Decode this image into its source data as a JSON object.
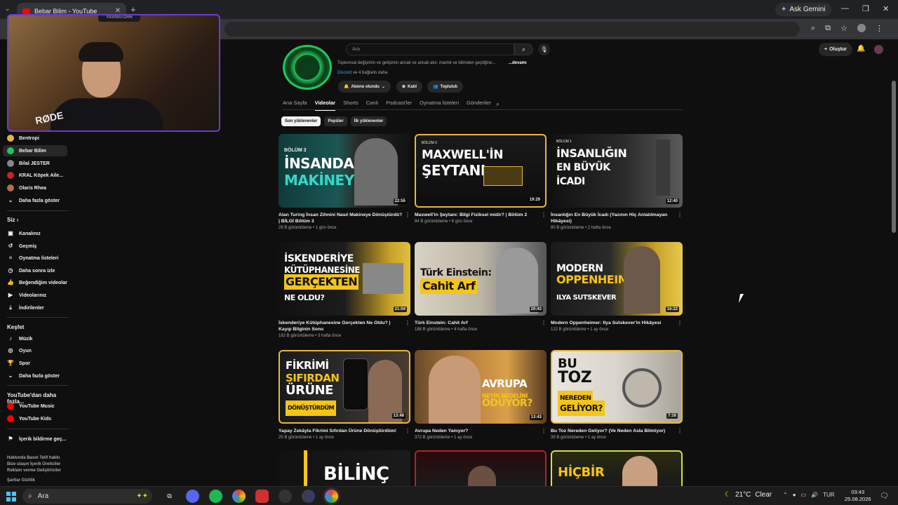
{
  "browser": {
    "tab_title": "Bebar Bilim - YouTube",
    "gemini_label": "Ask Gemini"
  },
  "youtube": {
    "search_placeholder": "Ara",
    "create_label": "Oluştur"
  },
  "webcam": {
    "overlay_name": "YASINATORR",
    "mic_brand": "RØDE"
  },
  "sidebar": {
    "subscriptions": [
      {
        "label": "Bentropi",
        "color": "#e8b04a"
      },
      {
        "label": "Bebar Bilim",
        "color": "#22c55e"
      },
      {
        "label": "Bilal JESTER",
        "color": "#888888"
      },
      {
        "label": "KRAL Köpek Aile...",
        "color": "#cc2222"
      },
      {
        "label": "Olaris Rhea",
        "color": "#b07050"
      }
    ],
    "show_more": "Daha fazla göster",
    "you_heading": "Siz",
    "you_items": [
      "Kanalınız",
      "Geçmiş",
      "Oynatma listeleri",
      "Daha sonra izle",
      "Beğendiğim videolar",
      "Videolarınız",
      "İndirilenler"
    ],
    "explore_heading": "Keşfet",
    "explore_items": [
      "Müzik",
      "Oyun",
      "Spor"
    ],
    "explore_more": "Daha fazla göster",
    "more_heading": "YouTube'dan daha fazla...",
    "more_items": [
      "YouTube Music",
      "YouTube Kids"
    ],
    "report": "İçerik bildirme geç...",
    "footer1": "Hakkında  Basın  Telif hakkı",
    "footer2": "Bize ulaşın  İçerik Üreticiler",
    "footer3": "Reklam verme  Geliştiriciler",
    "footer4": "Şartlar  Gizlilik"
  },
  "channel": {
    "description": "Toplumsal değişimin ve gelişimin ancak ve ancak akıl, mantık ve bilimden geçtiğine...",
    "more": "...devamı",
    "link_name": "Discord",
    "links_more": "ve 4 bağlantı daha",
    "subscribed_label": "Abone olundu",
    "join_label": "Katıl",
    "community_label": "Topluluk"
  },
  "tabs": [
    "Ana Sayfa",
    "Videolar",
    "Shorts",
    "Canlı",
    "Podcast'ler",
    "Oynatma listeleri",
    "Gönderiler"
  ],
  "active_tab": "Videolar",
  "chips": [
    "Son yüklenenler",
    "Popüler",
    "İlk yüklenenler"
  ],
  "videos": [
    {
      "thumb_text": [
        "BÖLÜM 3",
        "İNSANDAN",
        "MAKİNEYE"
      ],
      "duration": "22:55",
      "title": "Alan Turing İnsan Zihnini Nasıl Makineye Dönüştürdü? | BİLGİ Bölüm 3",
      "meta": "29 B görüntüleme • 1 gün önce"
    },
    {
      "thumb_text": [
        "BÖLÜM 2",
        "MAXWELL'İN",
        "ŞEYTANI"
      ],
      "duration": "19:29",
      "title": "Maxwell'in Şeytanı: Bilgi Fiziksel midir? | Bölüm 2",
      "meta": "84 B görüntüleme • 8 gün önce"
    },
    {
      "thumb_text": [
        "BÖLÜM 1",
        "İNSANLIĞIN",
        "EN BÜYÜK İCADI"
      ],
      "duration": "12:40",
      "title": "İnsanlığın En Büyük İcadı (Yazının Hiç Anlatılmayan Hikâyesi)",
      "meta": "80 B görüntüleme • 2 hafta önce"
    },
    {
      "thumb_text": [
        "İSKENDERİYE",
        "KÜTÜPHANESİNE",
        "GERÇEKTEN",
        "NE OLDU?"
      ],
      "duration": "21:04",
      "title": "İskenderiye Kütüphanesine Gerçekten Ne Oldu? | Kayıp Bilginin Sonu",
      "meta": "182 B görüntüleme • 3 hafta önce"
    },
    {
      "thumb_text": [
        "Türk Einstein:",
        "Cahit Arf"
      ],
      "duration": "20:43",
      "title": "Türk Einstein: Cahit Arf",
      "meta": "188 B görüntüleme • 4 hafta önce"
    },
    {
      "thumb_text": [
        "MODERN",
        "OPPENHEIMER",
        "ILYA SUTSKEVER"
      ],
      "duration": "16:22",
      "title": "Modern Oppenheimer: Ilya Sutskever'in Hikâyesi",
      "meta": "122 B görüntüleme • 1 ay önce"
    },
    {
      "thumb_text": [
        "FİKRİMİ",
        "SIFIRDAN",
        "ÜRÜNE",
        "DÖNÜŞTÜRDÜM"
      ],
      "duration": "13:48",
      "title": "Yapay Zekâyla Fikrimi Sıfırdan Ürüne Dönüştürdüm!",
      "meta": "25 B görüntüleme • 1 ay önce"
    },
    {
      "thumb_text": [
        "AVRUPA",
        "NEYİN BEDELİNİ",
        "ÖDÜYOR?"
      ],
      "duration": "13:43",
      "title": "Avrupa Neden Yanıyor?",
      "meta": "372 B görüntüleme • 1 ay önce"
    },
    {
      "thumb_text": [
        "BU",
        "TOZ",
        "NEREDEN",
        "GELİYOR?"
      ],
      "duration": "7:16",
      "title": "Bu Toz Nereden Geliyor? (Ve Neden Asla Bitmiyor)",
      "meta": "39 B görüntüleme • 1 ay önce"
    },
    {
      "thumb_text": [
        "BİLİNÇ"
      ],
      "duration": "",
      "title": "",
      "meta": ""
    },
    {
      "thumb_text": [
        ""
      ],
      "duration": "",
      "title": "",
      "meta": ""
    },
    {
      "thumb_text": [
        "HİÇBİR"
      ],
      "duration": "",
      "title": "",
      "meta": ""
    }
  ],
  "taskbar": {
    "search_placeholder": "Ara",
    "temperature": "21°C",
    "weather": "Clear",
    "lang": "TUR",
    "time": "03:43",
    "date": "25.08.2026"
  }
}
